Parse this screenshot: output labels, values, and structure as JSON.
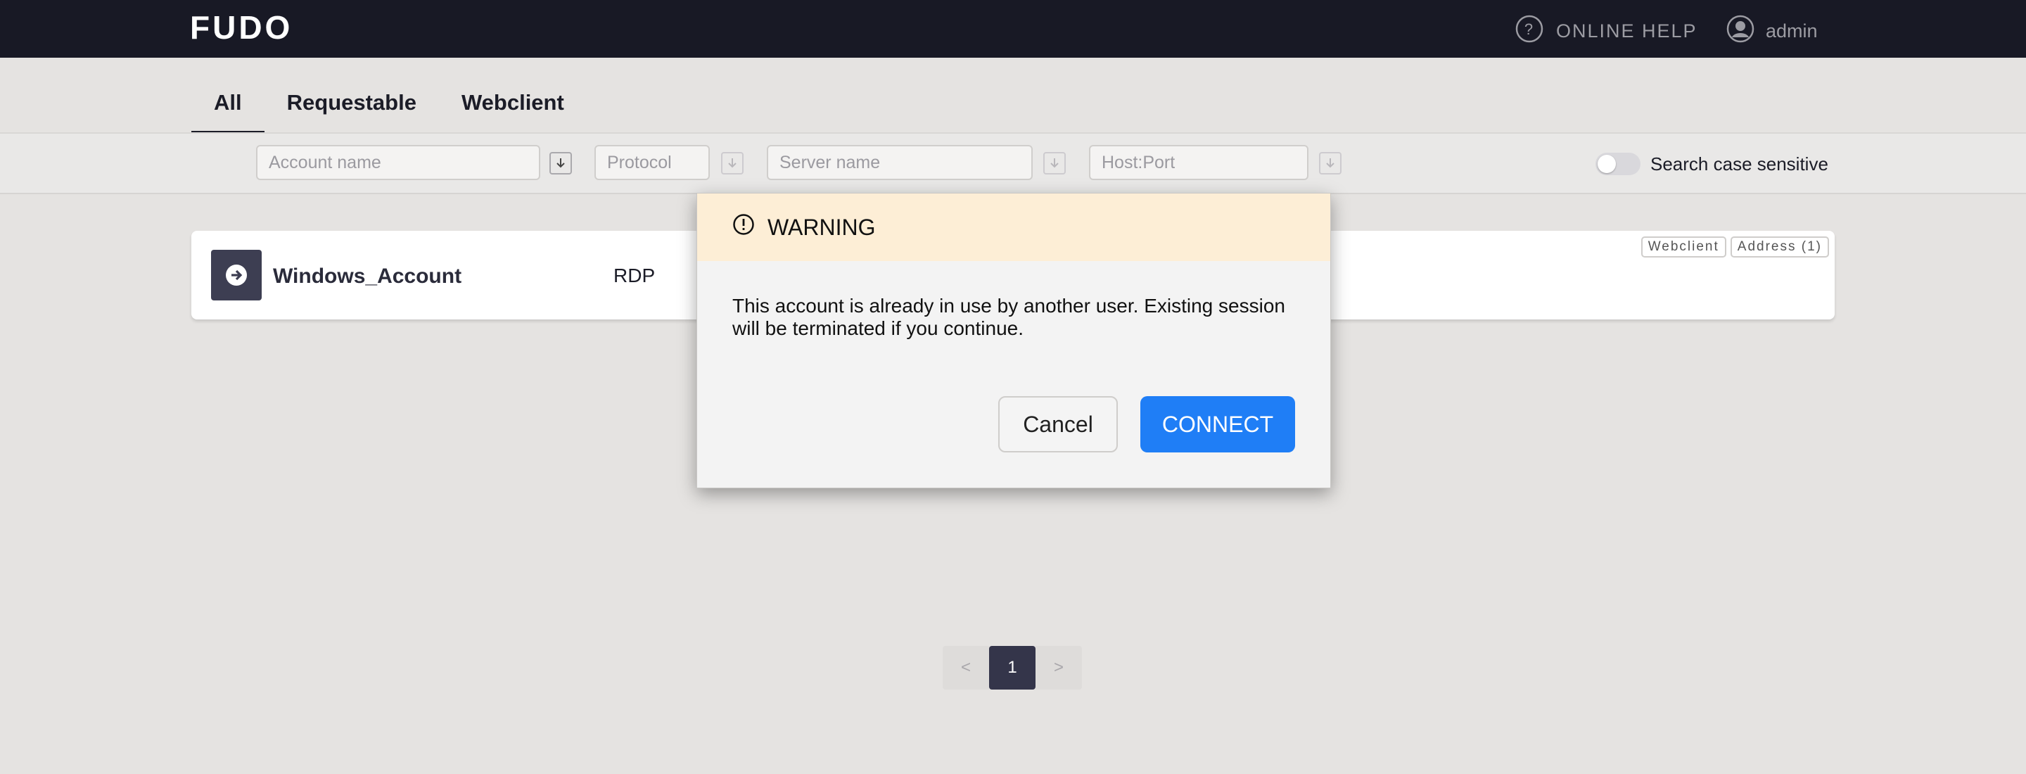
{
  "header": {
    "logo": "FUDO",
    "help_label": "ONLINE HELP",
    "user_label": "admin"
  },
  "tabs": [
    {
      "label": "All",
      "active": true
    },
    {
      "label": "Requestable",
      "active": false
    },
    {
      "label": "Webclient",
      "active": false
    }
  ],
  "filters": {
    "account_placeholder": "Account name",
    "protocol_placeholder": "Protocol",
    "server_placeholder": "Server name",
    "host_placeholder": "Host:Port",
    "case_sensitive_label": "Search case sensitive",
    "case_sensitive": false
  },
  "account": {
    "name": "Windows_Account",
    "protocol": "RDP",
    "badges": [
      "Webclient",
      "Address (1)"
    ]
  },
  "dialog": {
    "title": "WARNING",
    "message": "This account is already in use by another user. Existing session will be terminated if you continue.",
    "cancel_label": "Cancel",
    "connect_label": "CONNECT"
  },
  "pagination": {
    "prev": "<",
    "current": "1",
    "next": ">"
  },
  "colors": {
    "topbar": "#181925",
    "accent": "#1f7ef6",
    "warning_header": "#fdeed6",
    "page_bg": "#e5e3e1"
  }
}
